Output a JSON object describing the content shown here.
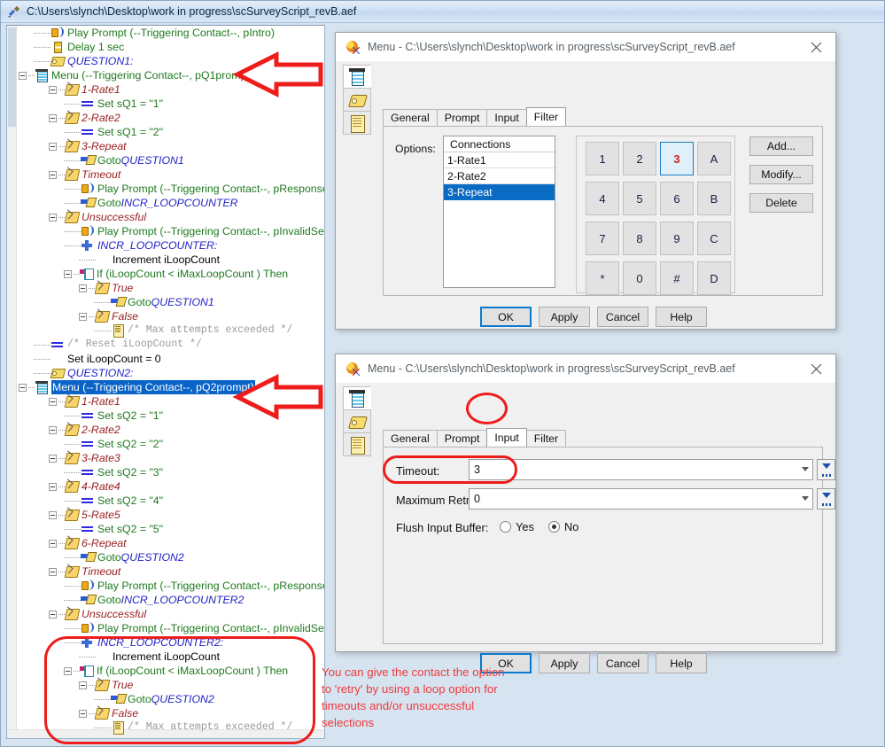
{
  "app": {
    "title": "C:\\Users\\slynch\\Desktop\\work in progress\\scSurveyScript_revB.aef",
    "icon": "script-app-icon"
  },
  "tree": [
    {
      "indent": 1,
      "expander": "none",
      "icon": "speaker-icon",
      "style": "green",
      "text": "Play Prompt (--Triggering Contact--, pIntro)"
    },
    {
      "indent": 1,
      "expander": "none",
      "icon": "hourglass-icon",
      "style": "green",
      "text": "Delay 1 sec"
    },
    {
      "indent": 1,
      "expander": "none",
      "icon": "tag-icon",
      "style": "blue-it",
      "text": "QUESTION1:"
    },
    {
      "indent": 0,
      "expander": "minus",
      "icon": "menu-icon",
      "style": "green",
      "text": "Menu (--Triggering Contact--, pQ1prompt)"
    },
    {
      "indent": 2,
      "expander": "minus",
      "icon": "branch-icon",
      "style": "red-it",
      "text": "1-Rate1"
    },
    {
      "indent": 3,
      "expander": "none",
      "icon": "set-icon",
      "style": "green",
      "text": "Set sQ1 = \"1\""
    },
    {
      "indent": 2,
      "expander": "minus",
      "icon": "branch-icon",
      "style": "red-it",
      "text": "2-Rate2"
    },
    {
      "indent": 3,
      "expander": "none",
      "icon": "set-icon",
      "style": "green",
      "text": "Set sQ1 = \"2\""
    },
    {
      "indent": 2,
      "expander": "minus",
      "icon": "branch-icon",
      "style": "red-it",
      "text": "3-Repeat"
    },
    {
      "indent": 3,
      "expander": "none",
      "icon": "goto-icon",
      "style": "goto",
      "text": "Goto ",
      "text2": "QUESTION1"
    },
    {
      "indent": 2,
      "expander": "minus",
      "icon": "branch-icon",
      "style": "red-it",
      "text": "Timeout"
    },
    {
      "indent": 3,
      "expander": "none",
      "icon": "speaker-icon",
      "style": "green",
      "text": "Play Prompt (--Triggering Contact--, pResponseTimeout)"
    },
    {
      "indent": 3,
      "expander": "none",
      "icon": "goto-icon",
      "style": "goto",
      "text": "Goto ",
      "text2": "INCR_LOOPCOUNTER"
    },
    {
      "indent": 2,
      "expander": "minus",
      "icon": "branch-icon",
      "style": "red-it",
      "text": "Unsuccessful"
    },
    {
      "indent": 3,
      "expander": "none",
      "icon": "speaker-icon",
      "style": "green",
      "text": "Play Prompt (--Triggering Contact--, pInvalidSelection)"
    },
    {
      "indent": 3,
      "expander": "none",
      "icon": "plus-icon",
      "style": "blue-it",
      "text": "INCR_LOOPCOUNTER:"
    },
    {
      "indent": 4,
      "expander": "none",
      "icon": "none",
      "style": "black",
      "text": "Increment iLoopCount"
    },
    {
      "indent": 3,
      "expander": "minus",
      "icon": "if-icon",
      "style": "green",
      "text": "If (iLoopCount < iMaxLoopCount ) Then"
    },
    {
      "indent": 4,
      "expander": "minus",
      "icon": "branch-icon",
      "style": "red-it",
      "text": "True"
    },
    {
      "indent": 5,
      "expander": "none",
      "icon": "goto-icon",
      "style": "goto",
      "text": "Goto ",
      "text2": "QUESTION1"
    },
    {
      "indent": 4,
      "expander": "minus",
      "icon": "branch-icon",
      "style": "red-it",
      "text": "False"
    },
    {
      "indent": 5,
      "expander": "none",
      "icon": "comment-icon",
      "style": "mono",
      "text": "/* Max attempts exceeded */"
    },
    {
      "indent": 1,
      "expander": "none",
      "icon": "set-icon",
      "style": "mono",
      "text": "/* Reset iLoopCount */"
    },
    {
      "indent": 1,
      "expander": "none",
      "icon": "none",
      "style": "black",
      "text": "Set iLoopCount = 0"
    },
    {
      "indent": 1,
      "expander": "none",
      "icon": "tag-icon",
      "style": "blue-it",
      "text": "QUESTION2:"
    },
    {
      "indent": 0,
      "expander": "minus",
      "icon": "menu-icon",
      "style": "selected",
      "text": "Menu (--Triggering Contact--, pQ2prompt)"
    },
    {
      "indent": 2,
      "expander": "minus",
      "icon": "branch-icon",
      "style": "red-it",
      "text": "1-Rate1"
    },
    {
      "indent": 3,
      "expander": "none",
      "icon": "set-icon",
      "style": "green",
      "text": "Set sQ2 = \"1\""
    },
    {
      "indent": 2,
      "expander": "minus",
      "icon": "branch-icon",
      "style": "red-it",
      "text": "2-Rate2"
    },
    {
      "indent": 3,
      "expander": "none",
      "icon": "set-icon",
      "style": "green",
      "text": "Set sQ2 = \"2\""
    },
    {
      "indent": 2,
      "expander": "minus",
      "icon": "branch-icon",
      "style": "red-it",
      "text": "3-Rate3"
    },
    {
      "indent": 3,
      "expander": "none",
      "icon": "set-icon",
      "style": "green",
      "text": "Set sQ2 = \"3\""
    },
    {
      "indent": 2,
      "expander": "minus",
      "icon": "branch-icon",
      "style": "red-it",
      "text": "4-Rate4"
    },
    {
      "indent": 3,
      "expander": "none",
      "icon": "set-icon",
      "style": "green",
      "text": "Set sQ2 = \"4\""
    },
    {
      "indent": 2,
      "expander": "minus",
      "icon": "branch-icon",
      "style": "red-it",
      "text": "5-Rate5"
    },
    {
      "indent": 3,
      "expander": "none",
      "icon": "set-icon",
      "style": "green",
      "text": "Set sQ2 = \"5\""
    },
    {
      "indent": 2,
      "expander": "minus",
      "icon": "branch-icon",
      "style": "red-it",
      "text": "6-Repeat"
    },
    {
      "indent": 3,
      "expander": "none",
      "icon": "goto-icon",
      "style": "goto",
      "text": "Goto ",
      "text2": "QUESTION2"
    },
    {
      "indent": 2,
      "expander": "minus",
      "icon": "branch-icon",
      "style": "red-it",
      "text": "Timeout"
    },
    {
      "indent": 3,
      "expander": "none",
      "icon": "speaker-icon",
      "style": "green",
      "text": "Play Prompt (--Triggering Contact--, pResponseTimeout)"
    },
    {
      "indent": 3,
      "expander": "none",
      "icon": "goto-icon",
      "style": "goto",
      "text": "Goto ",
      "text2": "INCR_LOOPCOUNTER2"
    },
    {
      "indent": 2,
      "expander": "minus",
      "icon": "branch-icon",
      "style": "red-it",
      "text": "Unsuccessful"
    },
    {
      "indent": 3,
      "expander": "none",
      "icon": "speaker-icon",
      "style": "green",
      "text": "Play Prompt (--Triggering Contact--, pInvalidSelection)"
    },
    {
      "indent": 3,
      "expander": "none",
      "icon": "plus-icon",
      "style": "blue-it",
      "text": "INCR_LOOPCOUNTER2:"
    },
    {
      "indent": 4,
      "expander": "none",
      "icon": "none",
      "style": "black",
      "text": "Increment iLoopCount"
    },
    {
      "indent": 3,
      "expander": "minus",
      "icon": "if-icon",
      "style": "green",
      "text": "If (iLoopCount < iMaxLoopCount ) Then"
    },
    {
      "indent": 4,
      "expander": "minus",
      "icon": "branch-icon",
      "style": "red-it",
      "text": "True"
    },
    {
      "indent": 5,
      "expander": "none",
      "icon": "goto-icon",
      "style": "goto",
      "text": "Goto ",
      "text2": "QUESTION2"
    },
    {
      "indent": 4,
      "expander": "minus",
      "icon": "branch-icon",
      "style": "red-it",
      "text": "False"
    },
    {
      "indent": 5,
      "expander": "none",
      "icon": "comment-icon",
      "style": "mono",
      "text": "/* Max attempts exceeded */"
    }
  ],
  "dialog_filter": {
    "title": "Menu - C:\\Users\\slynch\\Desktop\\work in progress\\scSurveyScript_revB.aef",
    "close_label": "✕",
    "side_tabs": [
      "menu-step-icon",
      "tag-step-icon",
      "document-step-icon"
    ],
    "tabs": [
      {
        "label": "General",
        "active": false
      },
      {
        "label": "Prompt",
        "active": false
      },
      {
        "label": "Input",
        "active": false
      },
      {
        "label": "Filter",
        "active": true
      }
    ],
    "options_label": "Options:",
    "list_header": "Connections",
    "list_items": [
      {
        "label": "1-Rate1",
        "selected": false
      },
      {
        "label": "2-Rate2",
        "selected": false
      },
      {
        "label": "3-Repeat",
        "selected": true
      }
    ],
    "keypad": [
      {
        "label": "1",
        "active": false
      },
      {
        "label": "2",
        "active": false
      },
      {
        "label": "3",
        "active": true
      },
      {
        "label": "A",
        "active": false
      },
      {
        "label": "4",
        "active": false
      },
      {
        "label": "5",
        "active": false
      },
      {
        "label": "6",
        "active": false
      },
      {
        "label": "B",
        "active": false
      },
      {
        "label": "7",
        "active": false
      },
      {
        "label": "8",
        "active": false
      },
      {
        "label": "9",
        "active": false
      },
      {
        "label": "C",
        "active": false
      },
      {
        "label": "*",
        "active": false
      },
      {
        "label": "0",
        "active": false
      },
      {
        "label": "#",
        "active": false
      },
      {
        "label": "D",
        "active": false
      }
    ],
    "side_buttons": [
      "Add...",
      "Modify...",
      "Delete"
    ],
    "footer_buttons": [
      {
        "label": "OK",
        "default": true
      },
      {
        "label": "Apply",
        "default": false
      },
      {
        "label": "Cancel",
        "default": false
      },
      {
        "label": "Help",
        "default": false
      }
    ]
  },
  "dialog_input": {
    "title": "Menu - C:\\Users\\slynch\\Desktop\\work in progress\\scSurveyScript_revB.aef",
    "close_label": "✕",
    "tabs": [
      {
        "label": "General",
        "active": false
      },
      {
        "label": "Prompt",
        "active": false
      },
      {
        "label": "Input",
        "active": true
      },
      {
        "label": "Filter",
        "active": false
      }
    ],
    "fields": {
      "timeout_label": "Timeout:",
      "timeout_value": "3",
      "retries_label": "Maximum Retries:",
      "retries_value": "0",
      "flush_label": "Flush Input Buffer:",
      "flush_yes": "Yes",
      "flush_no": "No",
      "flush_selected": "No"
    },
    "footer_buttons": [
      {
        "label": "OK",
        "default": true
      },
      {
        "label": "Apply",
        "default": false
      },
      {
        "label": "Cancel",
        "default": false
      },
      {
        "label": "Help",
        "default": false
      }
    ]
  },
  "annotation": {
    "note_text": "You can give the contact the option to 'retry' by using a loop option for timeouts and/or unsuccessful selections",
    "accent_color": "#ef1c1c",
    "note_color": "#ef3b3b"
  }
}
